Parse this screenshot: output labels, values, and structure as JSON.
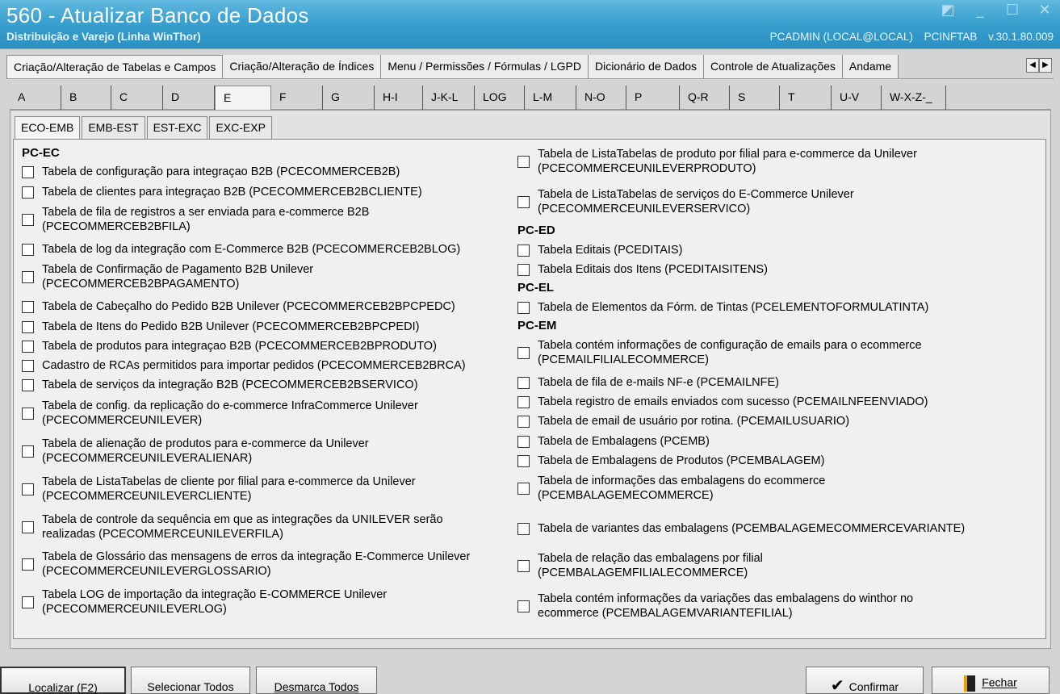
{
  "window": {
    "title": "560 - Atualizar Banco de Dados",
    "subtitle": "Distribuição e Varejo (Linha WinThor)",
    "connection": "PCADMIN (LOCAL@LOCAL)",
    "module": "PCINFTAB",
    "version": "v.30.1.80.009",
    "controls": [
      "restore-icon",
      "minimize-icon",
      "maximize-icon",
      "close-icon"
    ]
  },
  "main_tabs": [
    {
      "label": "Criação/Alteração de Tabelas e Campos",
      "active": true
    },
    {
      "label": "Criação/Alteração de Índices"
    },
    {
      "label": "Menu / Permissões / Fórmulas / LGPD"
    },
    {
      "label": "Dicionário de Dados"
    },
    {
      "label": "Controle de Atualizações"
    },
    {
      "label": "Andame"
    }
  ],
  "letter_tabs": [
    "A",
    "B",
    "C",
    "D",
    "E",
    "F",
    "G",
    "H-I",
    "J-K-L",
    "LOG",
    "L-M",
    "N-O",
    "P",
    "Q-R",
    "S",
    "T",
    "U-V",
    "W-X-Z-_"
  ],
  "active_letter": "E",
  "sub_tabs": [
    "ECO-EMB",
    "EMB-EST",
    "EST-EXC",
    "EXC-EXP"
  ],
  "active_sub_tab": "ECO-EMB",
  "left": {
    "group": "PC-EC",
    "items": [
      "Tabela de configuração para integraçao B2B (PCECOMMERCEB2B)",
      "Tabela de clientes para integraçao B2B (PCECOMMERCEB2BCLIENTE)",
      "Tabela de fila de registros a ser enviada para e-commerce B2B\n(PCECOMMERCEB2BFILA)",
      "Tabela de log da integração com E-Commerce B2B (PCECOMMERCEB2BLOG)",
      "Tabela de Confirmação de Pagamento B2B Unilever\n(PCECOMMERCEB2BPAGAMENTO)",
      "Tabela de Cabeçalho do Pedido B2B Unilever (PCECOMMERCEB2BPCPEDC)",
      "Tabela de Itens do Pedido B2B Unilever (PCECOMMERCEB2BPCPEDI)",
      "Tabela de produtos para integraçao B2B (PCECOMMERCEB2BPRODUTO)",
      "Cadastro de RCAs permitidos para importar pedidos (PCECOMMERCEB2BRCA)",
      "Tabela de serviços da integração B2B (PCECOMMERCEB2BSERVICO)",
      "Tabela de config. da replicação do e-commerce InfraCommerce Unilever\n(PCECOMMERCEUNILEVER)",
      "Tabela de alienação de produtos para e-commerce da Unilever\n(PCECOMMERCEUNILEVERALIENAR)",
      "Tabela de ListaTabelas de cliente por filial para e-commerce da Unilever\n(PCECOMMERCEUNILEVERCLIENTE)",
      "Tabela de controle da sequência em que as integrações da UNILEVER serão\nrealizadas (PCECOMMERCEUNILEVERFILA)",
      "Tabela de Glossário das mensagens de erros da integração E-Commerce Unilever\n(PCECOMMERCEUNILEVERGLOSSARIO)",
      "Tabela LOG de importação da integração E-COMMERCE Unilever\n(PCECOMMERCEUNILEVERLOG)"
    ]
  },
  "right": {
    "pc_ec_items": [
      "Tabela de ListaTabelas de produto por filial para e-commerce da Unilever\n(PCECOMMERCEUNILEVERPRODUTO)",
      "Tabela de ListaTabelas de serviços do E-Commerce Unilever\n(PCECOMMERCEUNILEVERSERVICO)"
    ],
    "group_ed": "PC-ED",
    "ed_items": [
      "Tabela Editais (PCEDITAIS)",
      "Tabela Editais dos Itens (PCEDITAISITENS)"
    ],
    "group_el": "PC-EL",
    "el_items": [
      "Tabela de Elementos da Fórm. de Tintas (PCELEMENTOFORMULATINTA)"
    ],
    "group_em": "PC-EM",
    "em_items": [
      "Tabela contém informações de configuração de emails para o ecommerce\n(PCEMAILFILIALECOMMERCE)",
      "Tabela de fila de e-mails NF-e (PCEMAILNFE)",
      "Tabela registro de emails enviados com sucesso (PCEMAILNFEENVIADO)",
      "Tabela de email de usuário por rotina. (PCEMAILUSUARIO)",
      "Tabela de Embalagens (PCEMB)",
      "Tabela de Embalagens de Produtos (PCEMBALAGEM)",
      "Tabela de informações das embalagens do ecommerce\n(PCEMBALAGEMECOMMERCE)",
      "Tabela de variantes das embalagens (PCEMBALAGEMECOMMERCEVARIANTE)",
      "Tabela de relação das embalagens por filial\n(PCEMBALAGEMFILIALECOMMERCE)",
      "Tabela contém informações da variações das embalagens do winthor no\necommerce (PCEMBALAGEMVARIANTEFILIAL)"
    ]
  },
  "buttons": {
    "localizar": "Localizar (F2)",
    "selecionar": "Selecionar Todos",
    "desmarca": "Desmarca Todos",
    "confirmar": "Confirmar",
    "fechar": "Fechar"
  }
}
